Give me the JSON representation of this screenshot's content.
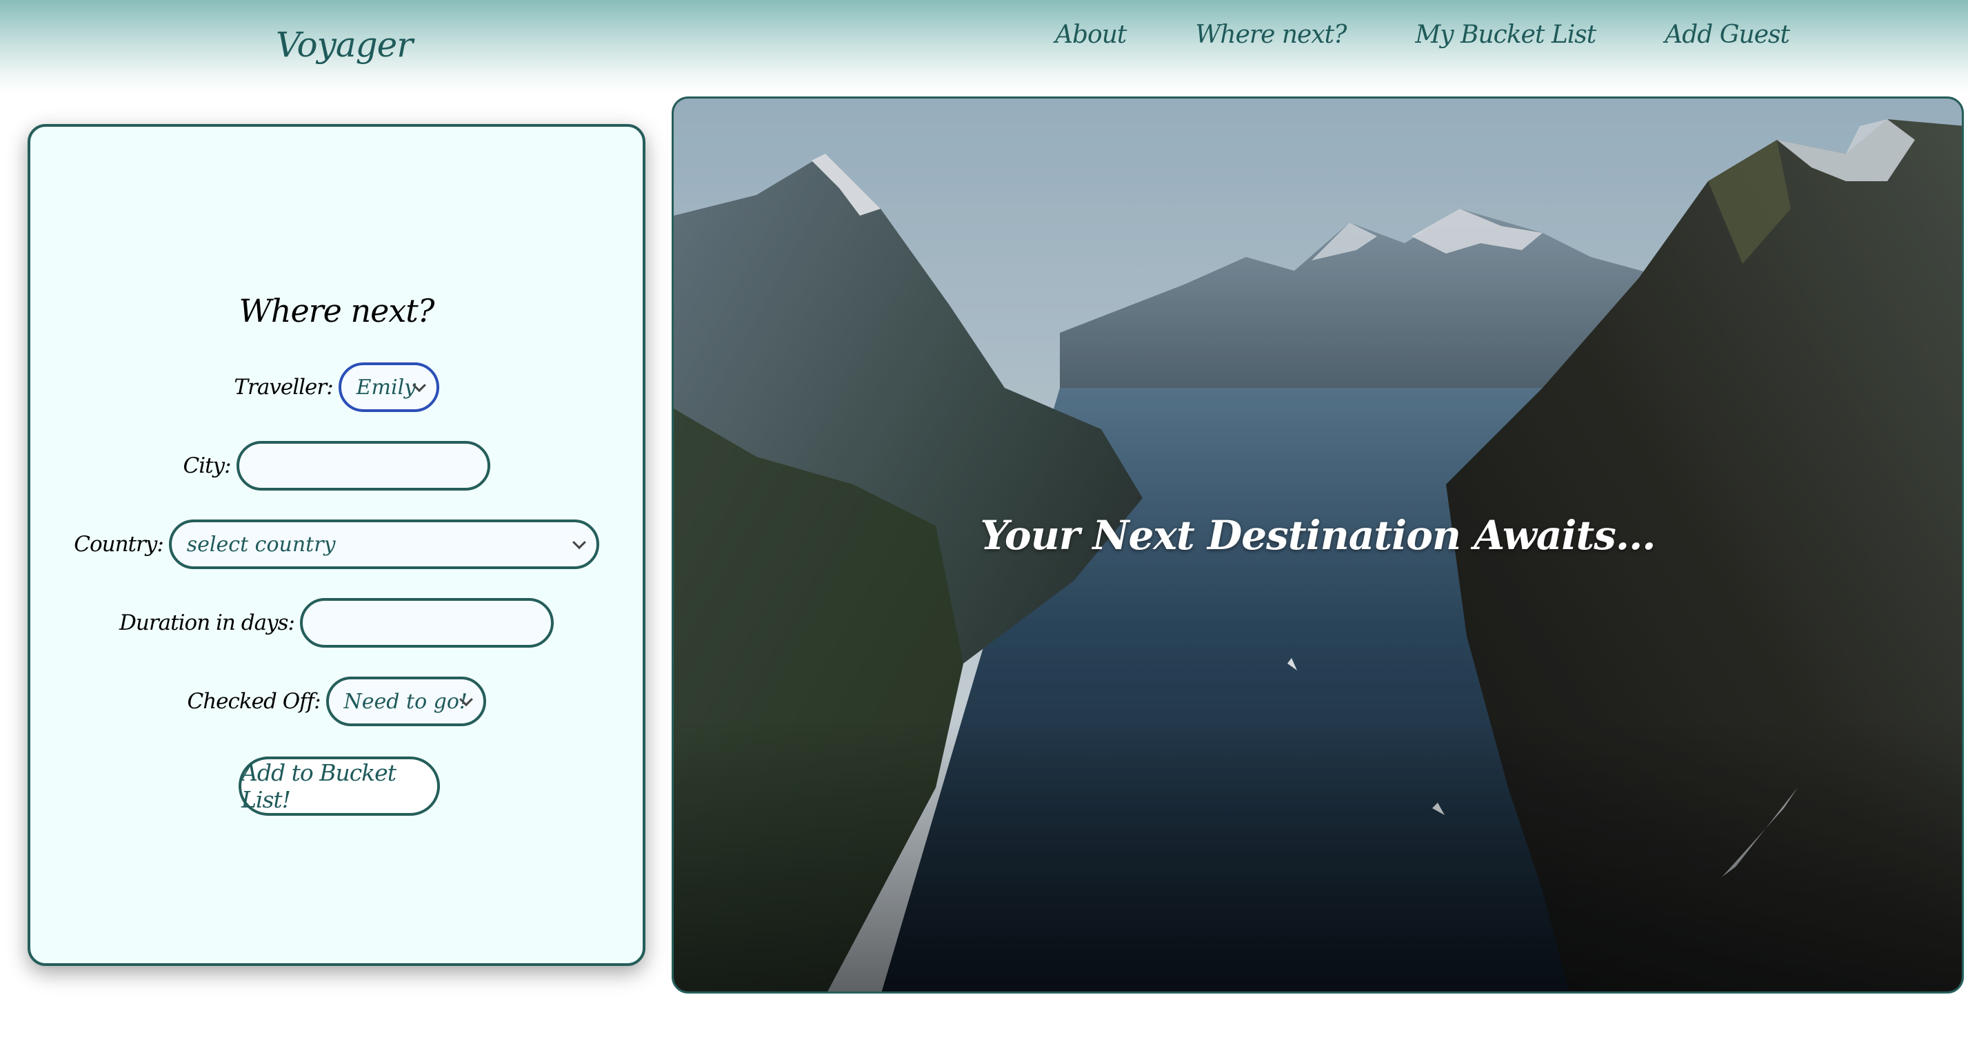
{
  "header": {
    "brand": "Voyager",
    "nav": [
      {
        "label": "About"
      },
      {
        "label": "Where next?"
      },
      {
        "label": "My Bucket List"
      },
      {
        "label": "Add Guest"
      }
    ]
  },
  "form": {
    "title": "Where next?",
    "traveller": {
      "label": "Traveller:",
      "value": "Emily"
    },
    "city": {
      "label": "City:",
      "value": ""
    },
    "country": {
      "label": "Country:",
      "value": "select country"
    },
    "duration": {
      "label": "Duration in days:",
      "value": ""
    },
    "checked_off": {
      "label": "Checked Off:",
      "value": "Need to go!"
    },
    "submit_label": "Add to Bucket List!"
  },
  "hero": {
    "tagline": "Your Next Destination Awaits...",
    "image": "fjord-mountains-photo"
  },
  "colors": {
    "accent": "#255e5a",
    "panel_bg": "#f1fefe",
    "focus_border": "#2b4fb7"
  }
}
